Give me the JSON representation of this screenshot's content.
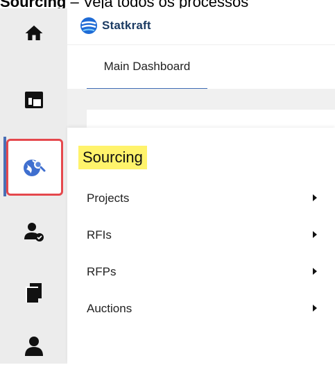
{
  "caption": {
    "title": "Sourcing",
    "rest": " – Veja todos os processos"
  },
  "header": {
    "brand_name": "Statkraft"
  },
  "tabs": [
    {
      "label": "Main Dashboard",
      "active": true
    }
  ],
  "sidebar": {
    "items": [
      {
        "icon": "home-icon"
      },
      {
        "icon": "dashboard-icon"
      },
      {
        "icon": "global-search-icon",
        "active": true
      },
      {
        "icon": "user-check-icon"
      },
      {
        "icon": "documents-icon"
      },
      {
        "icon": "user-icon"
      }
    ]
  },
  "menu": {
    "title": "Sourcing",
    "items": [
      {
        "label": "Projects"
      },
      {
        "label": "RFIs"
      },
      {
        "label": "RFPs"
      },
      {
        "label": "Auctions"
      }
    ]
  },
  "colors": {
    "highlight": "#fff36b",
    "active_box": "#e5484d",
    "accent": "#3d6ab3"
  }
}
